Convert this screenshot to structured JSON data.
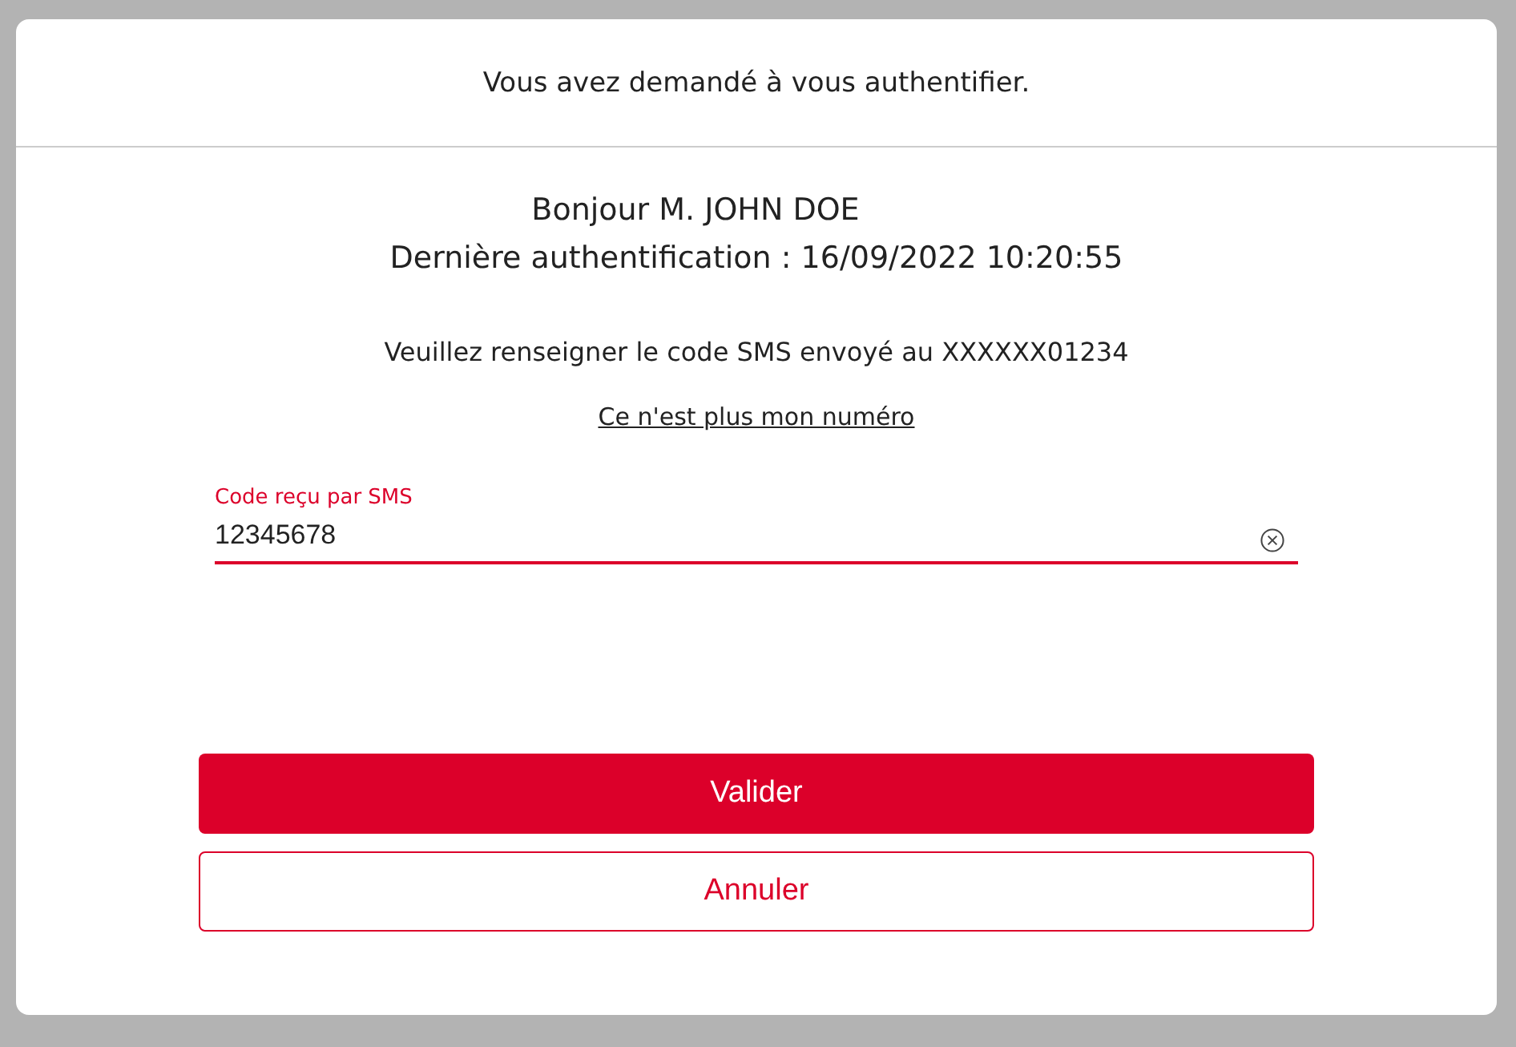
{
  "header": {
    "title": "Vous avez demandé à vous authentifier."
  },
  "greeting": {
    "line_1": "Bonjour M. JOHN DOE",
    "line_2": "Dernière authentification : 16/09/2022 10:20:55"
  },
  "instruction": "Veuillez renseigner le code SMS envoyé au XXXXXX01234",
  "link": "Ce n'est plus mon numéro",
  "code_field": {
    "label": "Code reçu par SMS",
    "value": "12345678"
  },
  "buttons": [
    {
      "label": "Valider",
      "kind": "primary"
    },
    {
      "label": "Annuler",
      "kind": "secondary"
    }
  ]
}
